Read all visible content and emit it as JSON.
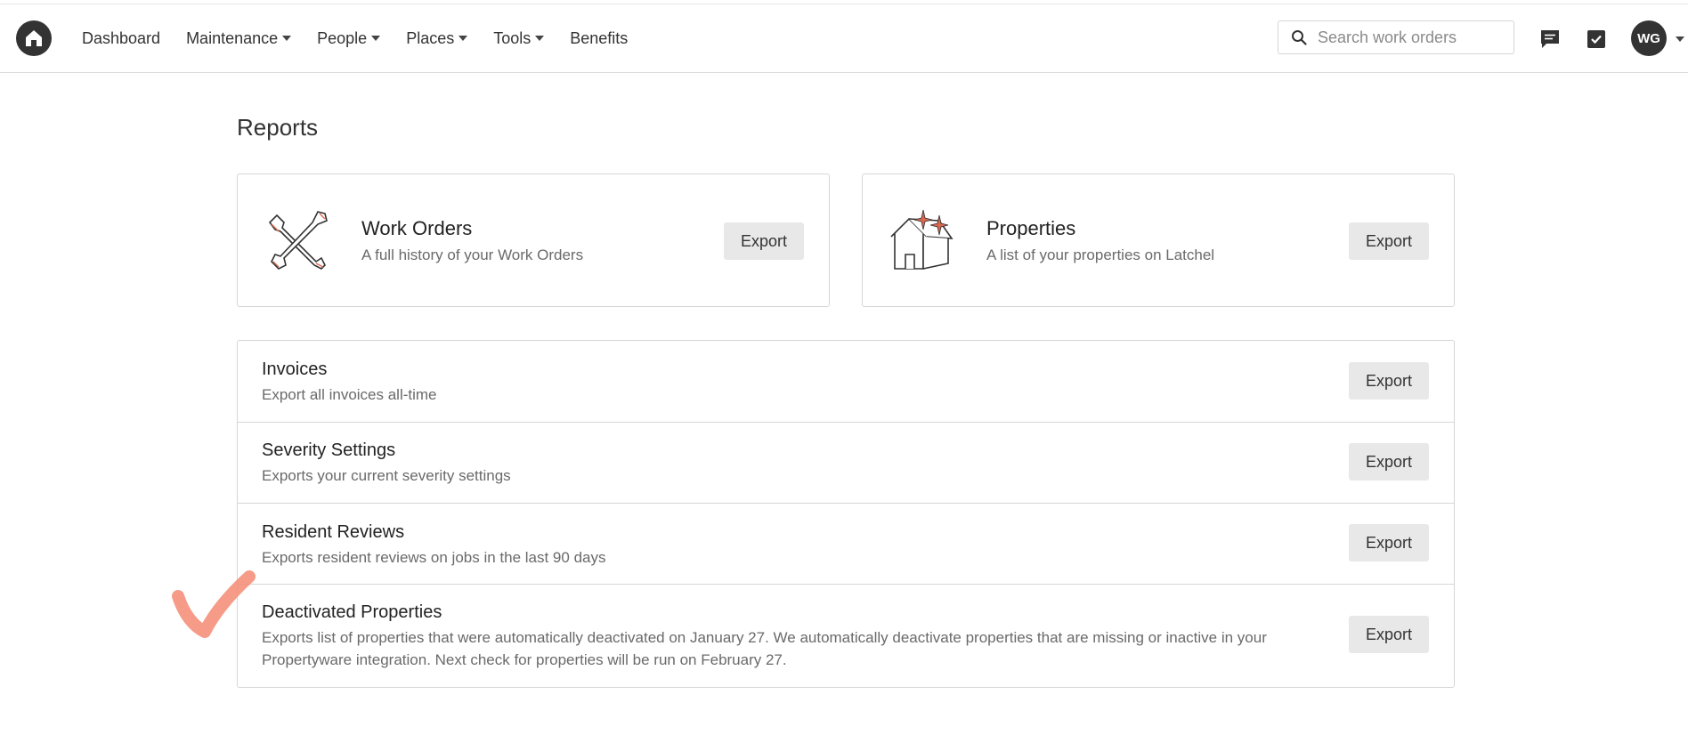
{
  "nav": {
    "items": [
      {
        "label": "Dashboard",
        "dropdown": false
      },
      {
        "label": "Maintenance",
        "dropdown": true
      },
      {
        "label": "People",
        "dropdown": true
      },
      {
        "label": "Places",
        "dropdown": true
      },
      {
        "label": "Tools",
        "dropdown": true
      },
      {
        "label": "Benefits",
        "dropdown": false
      }
    ],
    "search_placeholder": "Search work orders",
    "avatar_initials": "WG",
    "icons": [
      "home-logo-icon",
      "search-icon",
      "chat-icon",
      "checkbox-icon",
      "chevron-down-icon"
    ]
  },
  "page": {
    "title": "Reports"
  },
  "cards": [
    {
      "title": "Work Orders",
      "description": "A full history of your Work Orders",
      "button": "Export",
      "icon": "tools-icon"
    },
    {
      "title": "Properties",
      "description": "A list of your properties on Latchel",
      "button": "Export",
      "icon": "house-sparkle-icon"
    }
  ],
  "list": [
    {
      "title": "Invoices",
      "description": "Export all invoices all-time",
      "button": "Export"
    },
    {
      "title": "Severity Settings",
      "description": "Exports your current severity settings",
      "button": "Export"
    },
    {
      "title": "Resident Reviews",
      "description": "Exports resident reviews on jobs in the last 90 days",
      "button": "Export"
    },
    {
      "title": "Deactivated Properties",
      "description": "Exports list of properties that were automatically deactivated on January 27. We automatically deactivate properties that are missing or inactive in your Propertyware integration. Next check for properties will be run on February 27.",
      "button": "Export"
    }
  ],
  "colors": {
    "dark": "#333333",
    "accent": "#d9684f",
    "annotation": "#f4907a",
    "button_bg": "#e8e8e8",
    "border": "#d6d6d6"
  }
}
